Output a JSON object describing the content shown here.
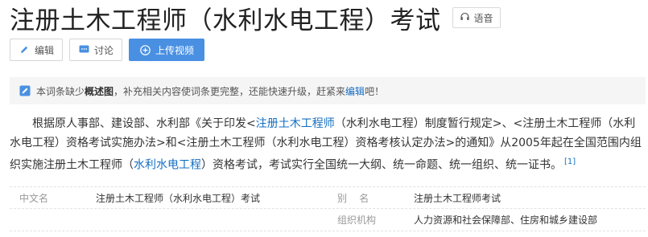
{
  "header": {
    "title": "注册土木工程师（水利水电工程）考试",
    "voice_label": "语音"
  },
  "toolbar": {
    "edit_label": "编辑",
    "discuss_label": "讨论",
    "upload_label": "上传视频"
  },
  "notice": {
    "prefix": "本词条缺少",
    "bold": "概述图",
    "middle": "，补充相关内容使词条更完整，还能快速升级，赶紧来",
    "link": "编辑",
    "suffix": "吧！"
  },
  "paragraph": {
    "t1": "根据原人事部、建设部、水利部《关于印发<",
    "link1": "注册土木工程师",
    "t2": "（水利水电工程）制度暂行规定>、<注册土木工程师（水利水电工程）资格考试实施办法>和<注册土木工程师（水利水电工程）资格考核认定办法>的通知》从2005年起在全国范围内组织实施注册土木工程师（",
    "link2": "水利水电工程",
    "t3": "）资格考试，考试实行全国统一大纲、统一命题、统一组织、统一证书。",
    "ref": "[1]"
  },
  "basic_info": {
    "row1": {
      "k1": "中文名",
      "v1": "注册土木工程师（水利水电工程）考试",
      "k2": "别    名",
      "v2": "注册土木工程师考试"
    },
    "row2": {
      "k2": "组织机构",
      "v2": "人力资源和社会保障部、住房和城乡建设部"
    }
  },
  "colors": {
    "link": "#136ec2",
    "primary_button": "#4a90e2",
    "notice_bg": "#f5f5f5"
  },
  "icons": [
    "speaker-icon",
    "pencil-icon",
    "chat-icon",
    "plus-circle-icon",
    "edit-note-icon"
  ]
}
